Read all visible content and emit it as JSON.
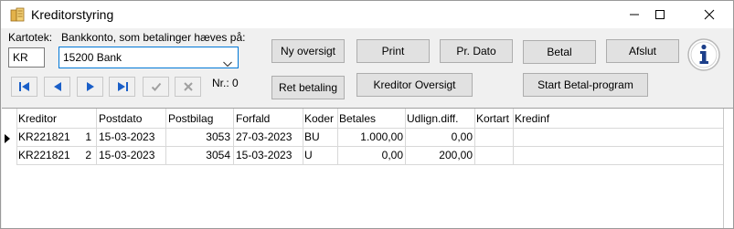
{
  "window": {
    "title": "Kreditorstyring"
  },
  "form": {
    "kartotek_label": "Kartotek:",
    "konto_label": "Bankkonto, som betalinger hæves på:",
    "kartotek_value": "KR",
    "konto_value": "15200  Bank",
    "nr_label": "Nr.: 0"
  },
  "buttons": {
    "ny_oversigt": "Ny oversigt",
    "print": "Print",
    "pr_dato": "Pr. Dato",
    "betal": "Betal",
    "afslut": "Afslut",
    "ret_betaling": "Ret betaling",
    "kreditor_oversigt": "Kreditor Oversigt",
    "start_betal": "Start Betal-program"
  },
  "table": {
    "headers": [
      "Kreditor",
      "Postdato",
      "Postbilag",
      "Forfald",
      "Koder",
      "Betales",
      "Udlign.diff.",
      "Kortart",
      "Kredinf"
    ],
    "rows": [
      {
        "kreditor": "KR221821",
        "nr": "1",
        "postdato": "15-03-2023",
        "postbilag": "3053",
        "forfald": "27-03-2023",
        "koder": "BU",
        "betales": "1.000,00",
        "udlign": "0,00",
        "kortart": "",
        "kredinf": ""
      },
      {
        "kreditor": "KR221821",
        "nr": "2",
        "postdato": "15-03-2023",
        "postbilag": "3054",
        "forfald": "15-03-2023",
        "koder": "U",
        "betales": "0,00",
        "udlign": "200,00",
        "kortart": "",
        "kredinf": ""
      }
    ]
  }
}
